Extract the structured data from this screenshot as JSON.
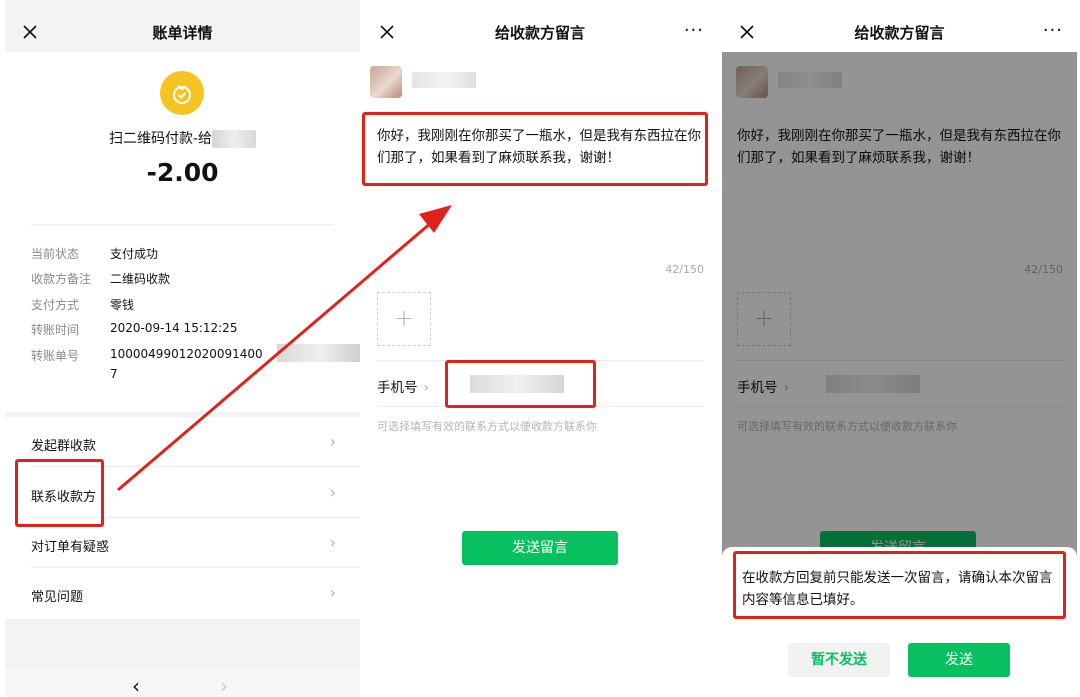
{
  "panel1": {
    "title": "账单详情",
    "pay_title": "扫二维码付款-给",
    "amount": "-2.00",
    "details": [
      {
        "key": "当前状态",
        "value": "支付成功"
      },
      {
        "key": "收款方备注",
        "value": "二维码收款"
      },
      {
        "key": "支付方式",
        "value": "零钱"
      },
      {
        "key": "转账时间",
        "value": "2020-09-14 15:12:25"
      },
      {
        "key": "转账单号",
        "value": "10000499012020091400",
        "value2": "7"
      }
    ],
    "menu": [
      {
        "label": "发起群收款"
      },
      {
        "label": "联系收款方"
      },
      {
        "label": "对订单有疑惑"
      },
      {
        "label": "常见问题"
      }
    ],
    "nav": {
      "back": "‹",
      "forward": "›"
    }
  },
  "panel2": {
    "title": "给收款方留言",
    "more": "···",
    "message": "你好，我刚刚在你那买了一瓶水，但是我有东西拉在你们那了，如果看到了麻烦联系我，谢谢！",
    "counter": "42/150",
    "add": "+",
    "phone_label": "手机号",
    "phone_chevron": "›",
    "hint": "可选择填写有效的联系方式以便收款方联系你",
    "send": "发送留言"
  },
  "panel3": {
    "title": "给收款方留言",
    "more": "···",
    "message": "你好，我刚刚在你那买了一瓶水，但是我有东西拉在你们那了，如果看到了麻烦联系我，谢谢！",
    "counter": "42/150",
    "add": "+",
    "phone_label": "手机号",
    "phone_chevron": "›",
    "hint": "可选择填写有效的联系方式以便收款方联系你",
    "send": "发送留言",
    "dialog_text": "在收款方回复前只能发送一次留言，请确认本次留言内容等信息已填好。",
    "cancel": "暂不发送",
    "confirm": "发送"
  },
  "colors": {
    "accent": "#07c160",
    "highlight": "#e0221c",
    "coin": "#f4c522"
  },
  "icons": [
    "close-icon",
    "more-icon",
    "coin-icon",
    "chevron-right-icon",
    "plus-icon",
    "back-icon",
    "forward-icon"
  ]
}
